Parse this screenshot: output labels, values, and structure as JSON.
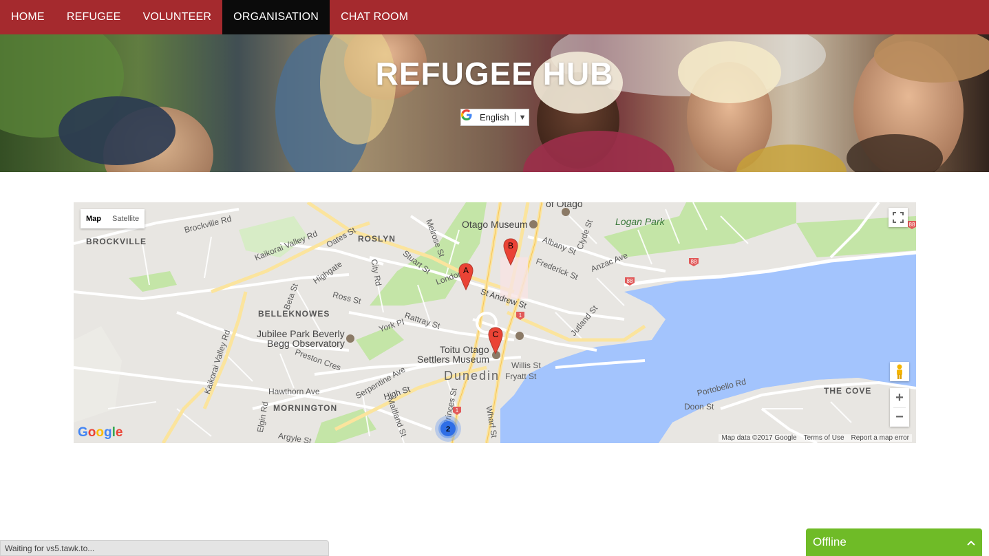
{
  "nav": {
    "items": [
      {
        "label": "HOME"
      },
      {
        "label": "REFUGEE"
      },
      {
        "label": "VOLUNTEER"
      },
      {
        "label": "ORGANISATION",
        "active": true
      },
      {
        "label": "CHAT ROOM"
      }
    ]
  },
  "hero": {
    "title": "REFUGEE HUB",
    "language": {
      "selected": "English",
      "icon": "google-g-icon"
    }
  },
  "map": {
    "type_buttons": {
      "map": "Map",
      "satellite": "Satellite",
      "selected": "Map"
    },
    "markers": [
      {
        "label": "A"
      },
      {
        "label": "B"
      },
      {
        "label": "C"
      }
    ],
    "cluster": {
      "count": "2"
    },
    "route_shields": [
      "1",
      "1",
      "88",
      "88",
      "88"
    ],
    "labels": {
      "brockville": "BROCKVILLE",
      "roslyn": "ROSLYN",
      "belleknowes": "BELLEKNOWES",
      "mornington": "MORNINGTON",
      "the_cove": "THE COVE",
      "dunedin": "Dunedin",
      "logan_park": "Logan Park",
      "otago_museum": "Otago Museum",
      "otago_uni": "of Otago",
      "jubilee_park_1": "Jubilee Park Beverly",
      "jubilee_park_2": "Begg Observatory",
      "toitu_1": "Toitu Otago",
      "toitu_2": "Settlers Museum",
      "kaikorai_valley_rd": "Kaikorai Valley Rd",
      "kaikorai_valley_rd2": "Kaikorai Valley Rd",
      "brockville_rd": "Brockville Rd",
      "stuart_st": "Stuart St",
      "st_andrew_st": "St Andrew St",
      "albany_st": "Albany St",
      "frederick_st": "Frederick St",
      "anzac_ave": "Anzac Ave",
      "high_st": "High St",
      "princes_st": "Princes St",
      "wharf_st": "Wharf St",
      "portobello_rd": "Portobello Rd",
      "hawthorn_ave": "Hawthorn Ave",
      "serpentine_ave": "Serpentine Ave",
      "highgate": "Highgate",
      "ross_st": "Ross St",
      "london_st": "London St",
      "rattray_st": "Rattray St",
      "york_pl": "York Pl",
      "preston_cres": "Preston Cres",
      "jutland_st": "Jutland St",
      "willis_st": "Willis St",
      "fryatt_st": "Fryatt St",
      "doon_st": "Doon St",
      "oates_st": "Oates St",
      "city_rd": "City Rd",
      "beta_st": "Beta St",
      "melrose_st": "Melrose St",
      "clyde_st": "Clyde St",
      "elgin_rd": "Elgin Rd",
      "argyle_st": "Argyle St",
      "maitland_st": "Maitland St"
    },
    "attribution": {
      "data": "Map data ©2017 Google",
      "terms": "Terms of Use",
      "report": "Report a map error"
    },
    "logo": "Google"
  },
  "status_bar": {
    "text": "Waiting for vs5.tawk.to..."
  },
  "chat_widget": {
    "label": "Offline",
    "icon": "chevron-up-icon"
  },
  "colors": {
    "nav_bg": "#a52a2e",
    "nav_active": "#0b0b0b",
    "chat_green": "#6fbb27",
    "water": "#a3c4fd",
    "road_major": "#fbe49d",
    "park": "#c4e5a7"
  }
}
